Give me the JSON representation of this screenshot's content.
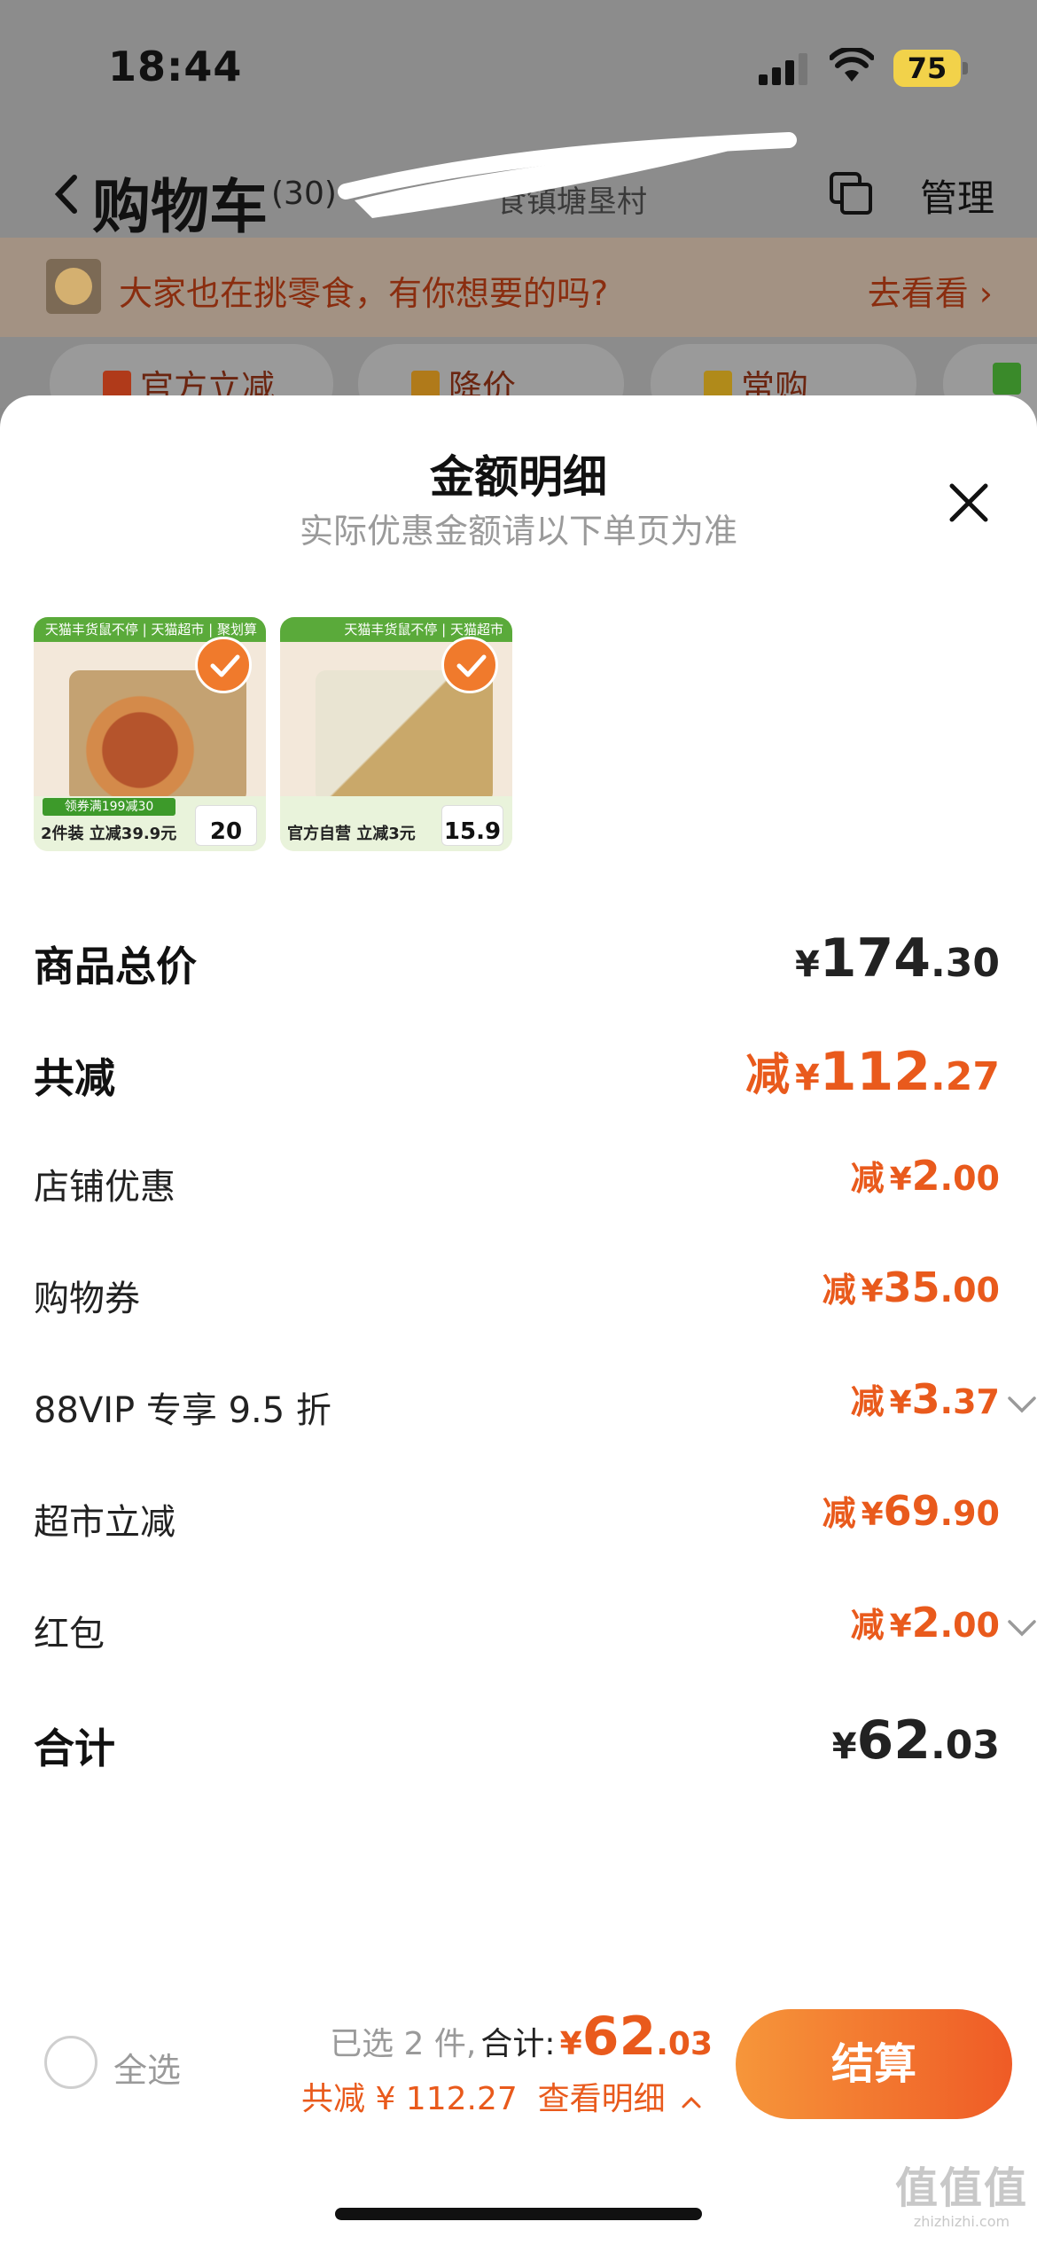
{
  "status_bar": {
    "time": "18:44",
    "battery": "75"
  },
  "nav": {
    "title": "购物车",
    "count": "(30)",
    "address": "食镇塘垦村",
    "manage": "管理"
  },
  "banner": {
    "text": "大家也在挑零食，有你想要的吗?",
    "link": "去看看"
  },
  "chips": [
    "官方立减",
    "降价",
    "常购"
  ],
  "sheet": {
    "title": "金额明细",
    "subtitle": "实际优惠金额请以下单页为准",
    "products": [
      {
        "tag": "天猫丰货鼠不停 | 天猫超市 | 聚划算",
        "coupon": "领券满199减30",
        "label": "2件装 立减39.9元",
        "price": "20"
      },
      {
        "tag": "天猫丰货鼠不停 | 天猫超市",
        "coupon": "",
        "label": "官方自营 立减3元",
        "price": "15.9"
      }
    ],
    "rows": [
      {
        "label": "商品总价",
        "prefix": "",
        "currency": "¥",
        "int": "174",
        "dec": ".30"
      },
      {
        "label": "共减",
        "prefix": "减",
        "currency": "¥",
        "int": "112",
        "dec": ".27"
      },
      {
        "label": "店铺优惠",
        "prefix": "减",
        "currency": "¥",
        "int": "2",
        "dec": ".00"
      },
      {
        "label": "购物券",
        "prefix": "减",
        "currency": "¥",
        "int": "35",
        "dec": ".00"
      },
      {
        "label": "88VIP 专享 9.5 折",
        "prefix": "减",
        "currency": "¥",
        "int": "3",
        "dec": ".37"
      },
      {
        "label": "超市立减",
        "prefix": "减",
        "currency": "¥",
        "int": "69",
        "dec": ".90"
      },
      {
        "label": "红包",
        "prefix": "减",
        "currency": "¥",
        "int": "2",
        "dec": ".00"
      },
      {
        "label": "合计",
        "prefix": "",
        "currency": "¥",
        "int": "62",
        "dec": ".03"
      }
    ]
  },
  "bottom": {
    "select_all": "全选",
    "selected": "已选 2 件,",
    "total_label": "合计:",
    "currency": "¥",
    "total_int": "62",
    "total_dec": ".03",
    "saved": "共减 ¥ 112.27",
    "detail": "查看明细",
    "checkout": "结算"
  },
  "watermark": {
    "mark": "值值值",
    "url": "zhizhizhi.com"
  },
  "colors": {
    "accent": "#e95a1c",
    "checkout_start": "#f6963a",
    "checkout_end": "#ef5b26"
  }
}
